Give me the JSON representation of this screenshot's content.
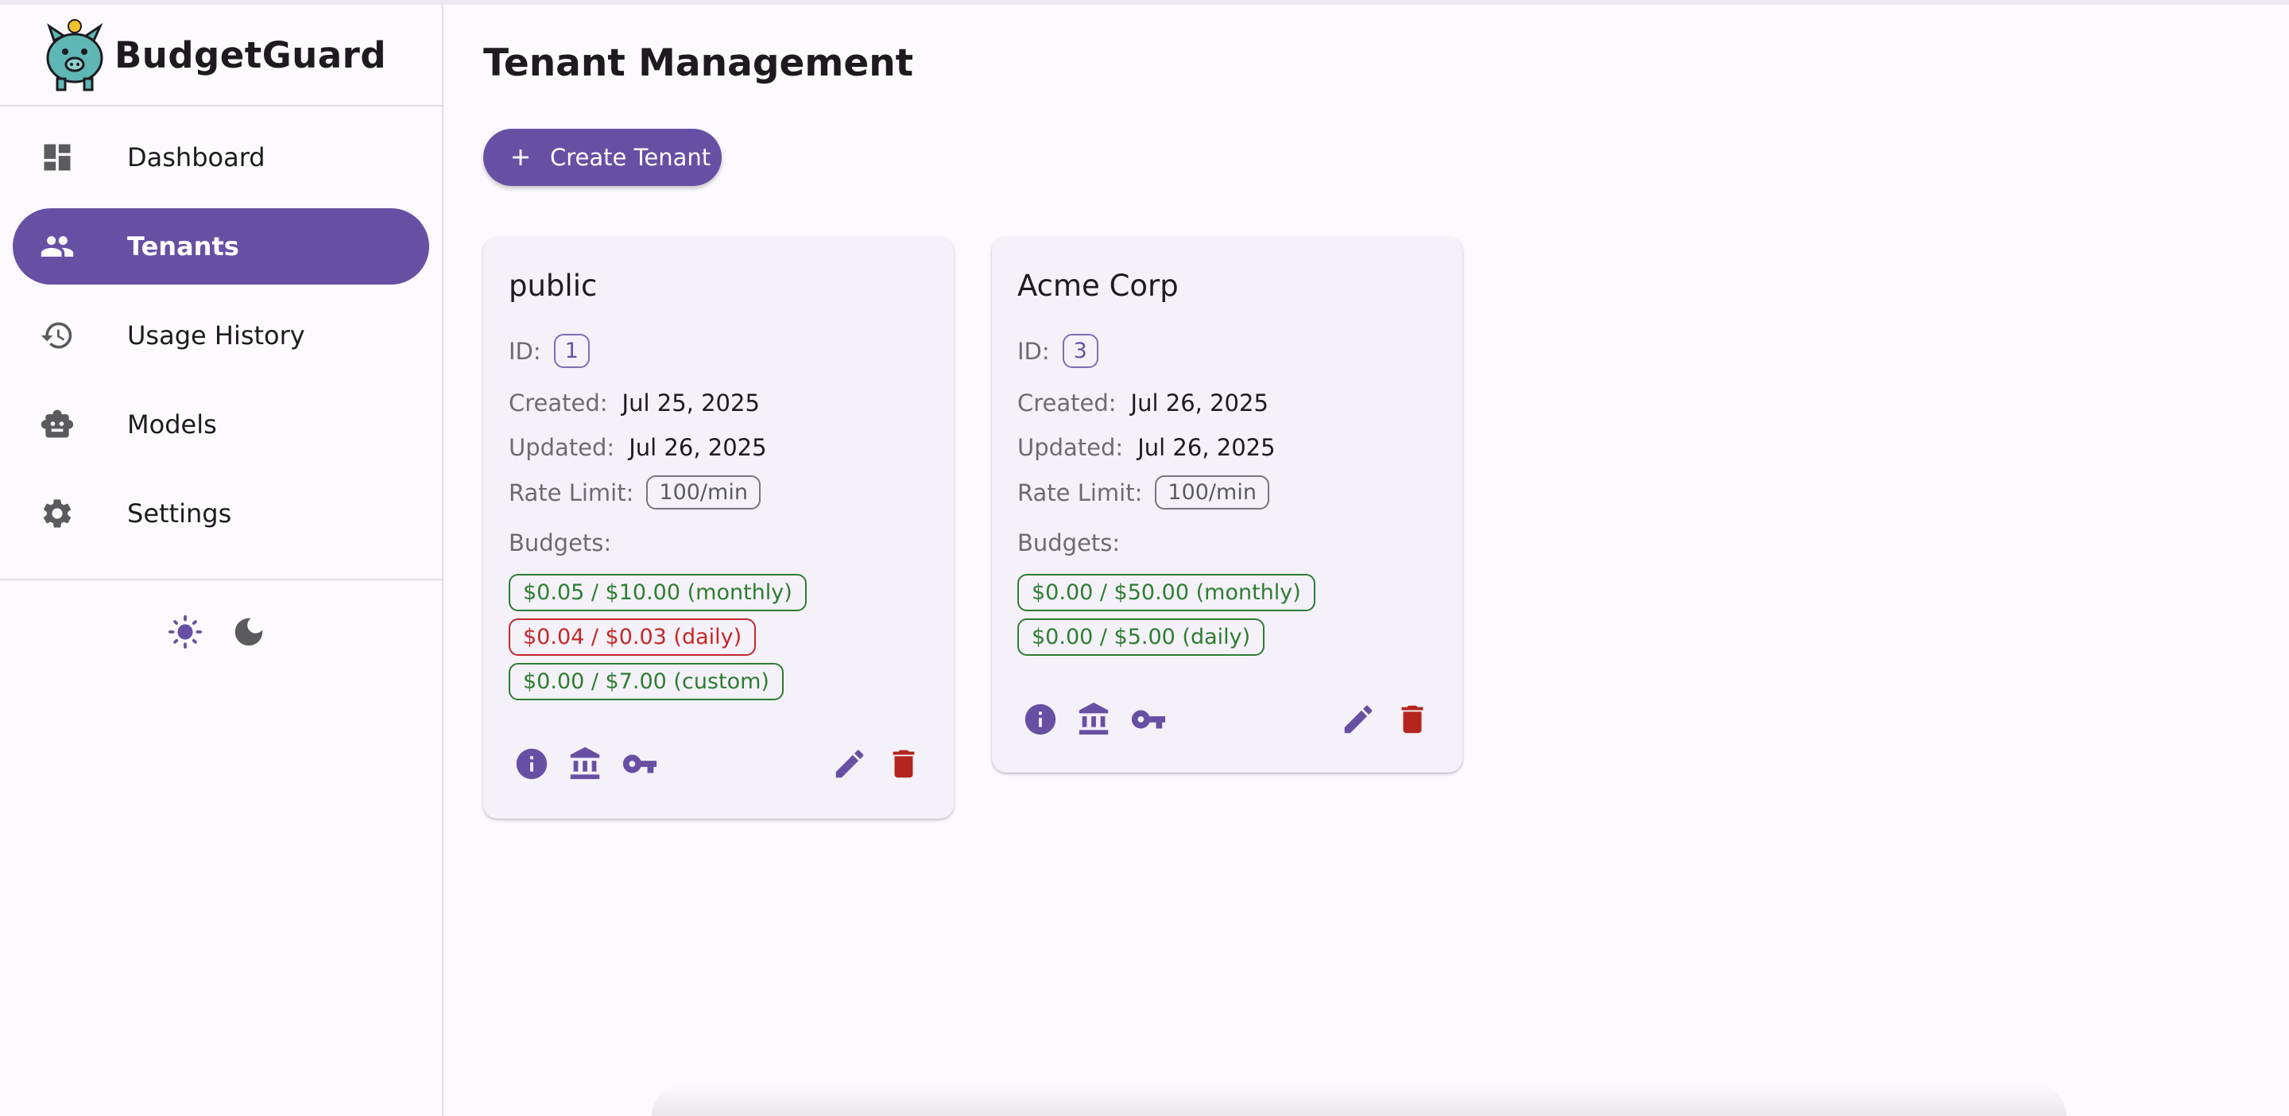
{
  "app": {
    "name": "BudgetGuard"
  },
  "sidebar": {
    "items": [
      {
        "label": "Dashboard",
        "icon": "dashboard-icon",
        "active": false
      },
      {
        "label": "Tenants",
        "icon": "people-icon",
        "active": true
      },
      {
        "label": "Usage History",
        "icon": "history-icon",
        "active": false
      },
      {
        "label": "Models",
        "icon": "robot-icon",
        "active": false
      },
      {
        "label": "Settings",
        "icon": "gear-icon",
        "active": false
      }
    ],
    "theme_icons": [
      "sun-icon",
      "moon-icon"
    ]
  },
  "page": {
    "title": "Tenant Management",
    "create_button": "Create Tenant"
  },
  "labels": {
    "id": "ID:",
    "created": "Created:",
    "updated": "Updated:",
    "rate_limit": "Rate Limit:",
    "budgets": "Budgets:"
  },
  "tenants": [
    {
      "name": "public",
      "id": "1",
      "created": "Jul 25, 2025",
      "updated": "Jul 26, 2025",
      "rate_limit": "100/min",
      "budgets": [
        {
          "text": "$0.05 / $10.00 (monthly)",
          "status": "ok"
        },
        {
          "text": "$0.04 / $0.03 (daily)",
          "status": "over"
        },
        {
          "text": "$0.00 / $7.00 (custom)",
          "status": "ok"
        }
      ]
    },
    {
      "name": "Acme Corp",
      "id": "3",
      "created": "Jul 26, 2025",
      "updated": "Jul 26, 2025",
      "rate_limit": "100/min",
      "budgets": [
        {
          "text": "$0.00 / $50.00 (monthly)",
          "status": "ok"
        },
        {
          "text": "$0.00 / $5.00 (daily)",
          "status": "ok"
        }
      ]
    }
  ],
  "colors": {
    "primary": "#6750a4",
    "ok": "#2e7d32",
    "over": "#c62828",
    "delete": "#b3261e"
  }
}
